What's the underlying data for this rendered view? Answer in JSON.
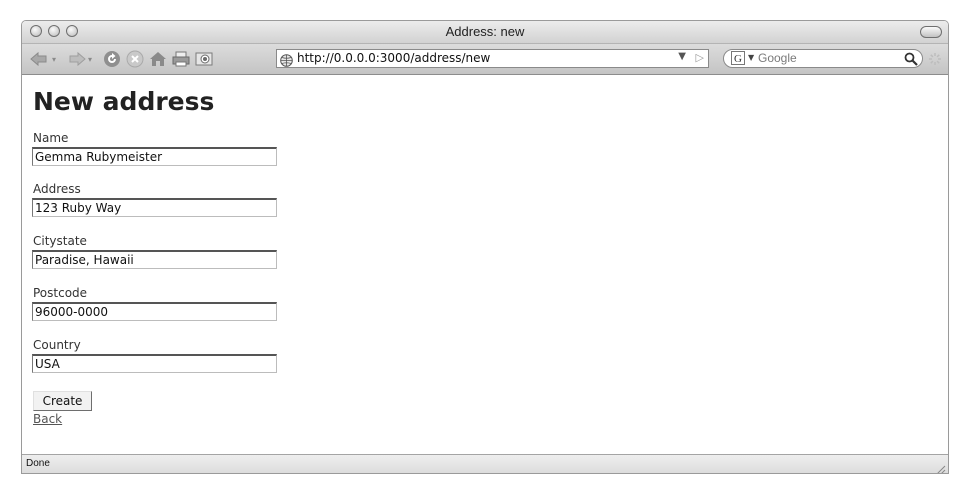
{
  "window": {
    "title": "Address: new"
  },
  "toolbar": {
    "url": "http://0.0.0.0:3000/address/new",
    "search_placeholder": "Google",
    "search_engine_glyph": "G",
    "icons": [
      "back-icon",
      "forward-icon",
      "reload-icon",
      "stop-icon",
      "home-icon",
      "print-icon",
      "screenshot-icon"
    ]
  },
  "page": {
    "heading": "New address",
    "fields": [
      {
        "label": "Name",
        "value": "Gemma Rubymeister"
      },
      {
        "label": "Address",
        "value": "123 Ruby Way"
      },
      {
        "label": "Citystate",
        "value": "Paradise, Hawaii"
      },
      {
        "label": "Postcode",
        "value": "96000-0000"
      },
      {
        "label": "Country",
        "value": "USA"
      }
    ],
    "submit_label": "Create",
    "back_label": "Back"
  },
  "status": {
    "text": "Done"
  }
}
